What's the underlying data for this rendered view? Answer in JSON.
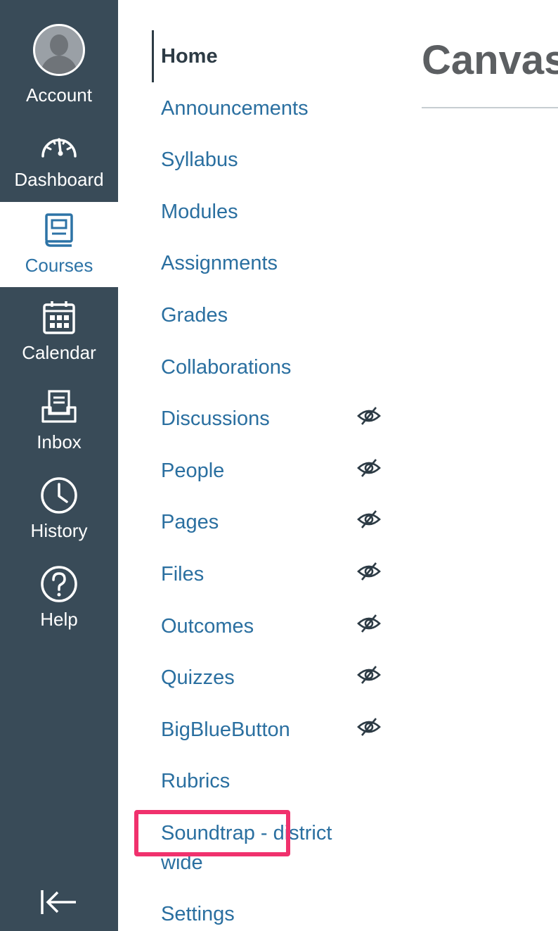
{
  "global_nav": {
    "account": "Account",
    "dashboard": "Dashboard",
    "courses": "Courses",
    "calendar": "Calendar",
    "inbox": "Inbox",
    "history": "History",
    "help": "Help"
  },
  "course_nav": {
    "home": "Home",
    "announcements": "Announcements",
    "syllabus": "Syllabus",
    "modules": "Modules",
    "assignments": "Assignments",
    "grades": "Grades",
    "collaborations": "Collaborations",
    "discussions": "Discussions",
    "people": "People",
    "pages": "Pages",
    "files": "Files",
    "outcomes": "Outcomes",
    "quizzes": "Quizzes",
    "bigbluebutton": "BigBlueButton",
    "rubrics": "Rubrics",
    "soundtrap": "Soundtrap - district wide",
    "settings": "Settings"
  },
  "main": {
    "title": "Canvas"
  },
  "colors": {
    "nav_bg": "#394b58",
    "link": "#2a6fa0",
    "active_text": "#2d3b45",
    "highlight": "#f0316d"
  }
}
